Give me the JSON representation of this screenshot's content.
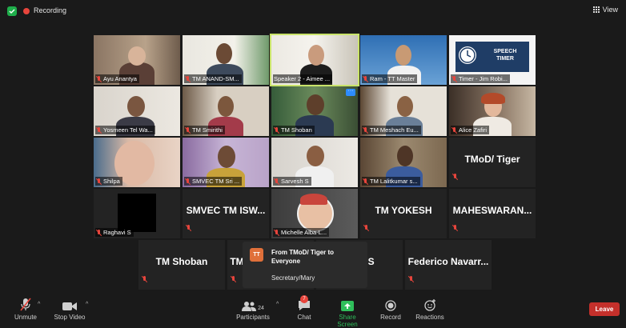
{
  "topbar": {
    "recording_label": "Recording",
    "view_label": "View"
  },
  "row1": [
    {
      "name": "Ayu Anantya"
    },
    {
      "name": "TM ANAND-SM..."
    },
    {
      "name": "Speaker 2 - Aimee ..."
    },
    {
      "name": "Ram - TT Master"
    },
    {
      "name": "Timer - Jim Robi...",
      "slide_title": "SPEECH TIMER"
    }
  ],
  "row2": [
    {
      "name": "Yosmeen Tel Wa..."
    },
    {
      "name": "TM Smirithi"
    },
    {
      "name": "TM Shoban"
    },
    {
      "name": "TM Meshach Eu..."
    },
    {
      "name": "Alice Zafiri"
    }
  ],
  "row3": [
    {
      "name": "Shilpa"
    },
    {
      "name": "SMVEC TM Sri ..."
    },
    {
      "name": "Sarvesh S"
    },
    {
      "name": "TM Lalitkumar s..."
    },
    {
      "display": "TMoD/ Tiger"
    }
  ],
  "row4": [
    {
      "name": "Raghavi S"
    },
    {
      "display": "SMVEC TM ISW..."
    },
    {
      "name": "Michelle Alba-L..."
    },
    {
      "display": "TM YOKESH"
    },
    {
      "display": "MAHESWARAN..."
    }
  ],
  "row5": [
    {
      "display": "TM Shoban"
    },
    {
      "display": "TM"
    },
    {
      "display": "MI.S"
    },
    {
      "display": "Federico  Navarr..."
    }
  ],
  "chat_toast": {
    "avatar": "TT",
    "from": "From TMoD/ Tiger to Everyone",
    "message": "Secretary/Mary"
  },
  "toolbar": {
    "unmute": "Unmute",
    "stop_video": "Stop Video",
    "participants": "Participants",
    "participants_count": "24",
    "chat": "Chat",
    "chat_badge": "7",
    "share_screen": "Share Screen",
    "record": "Record",
    "reactions": "Reactions",
    "leave": "Leave"
  },
  "colors": {
    "speaker_border": "#c9e36a",
    "leave": "#c4302b",
    "share": "#2fbf5b",
    "recording": "#e8453c"
  }
}
